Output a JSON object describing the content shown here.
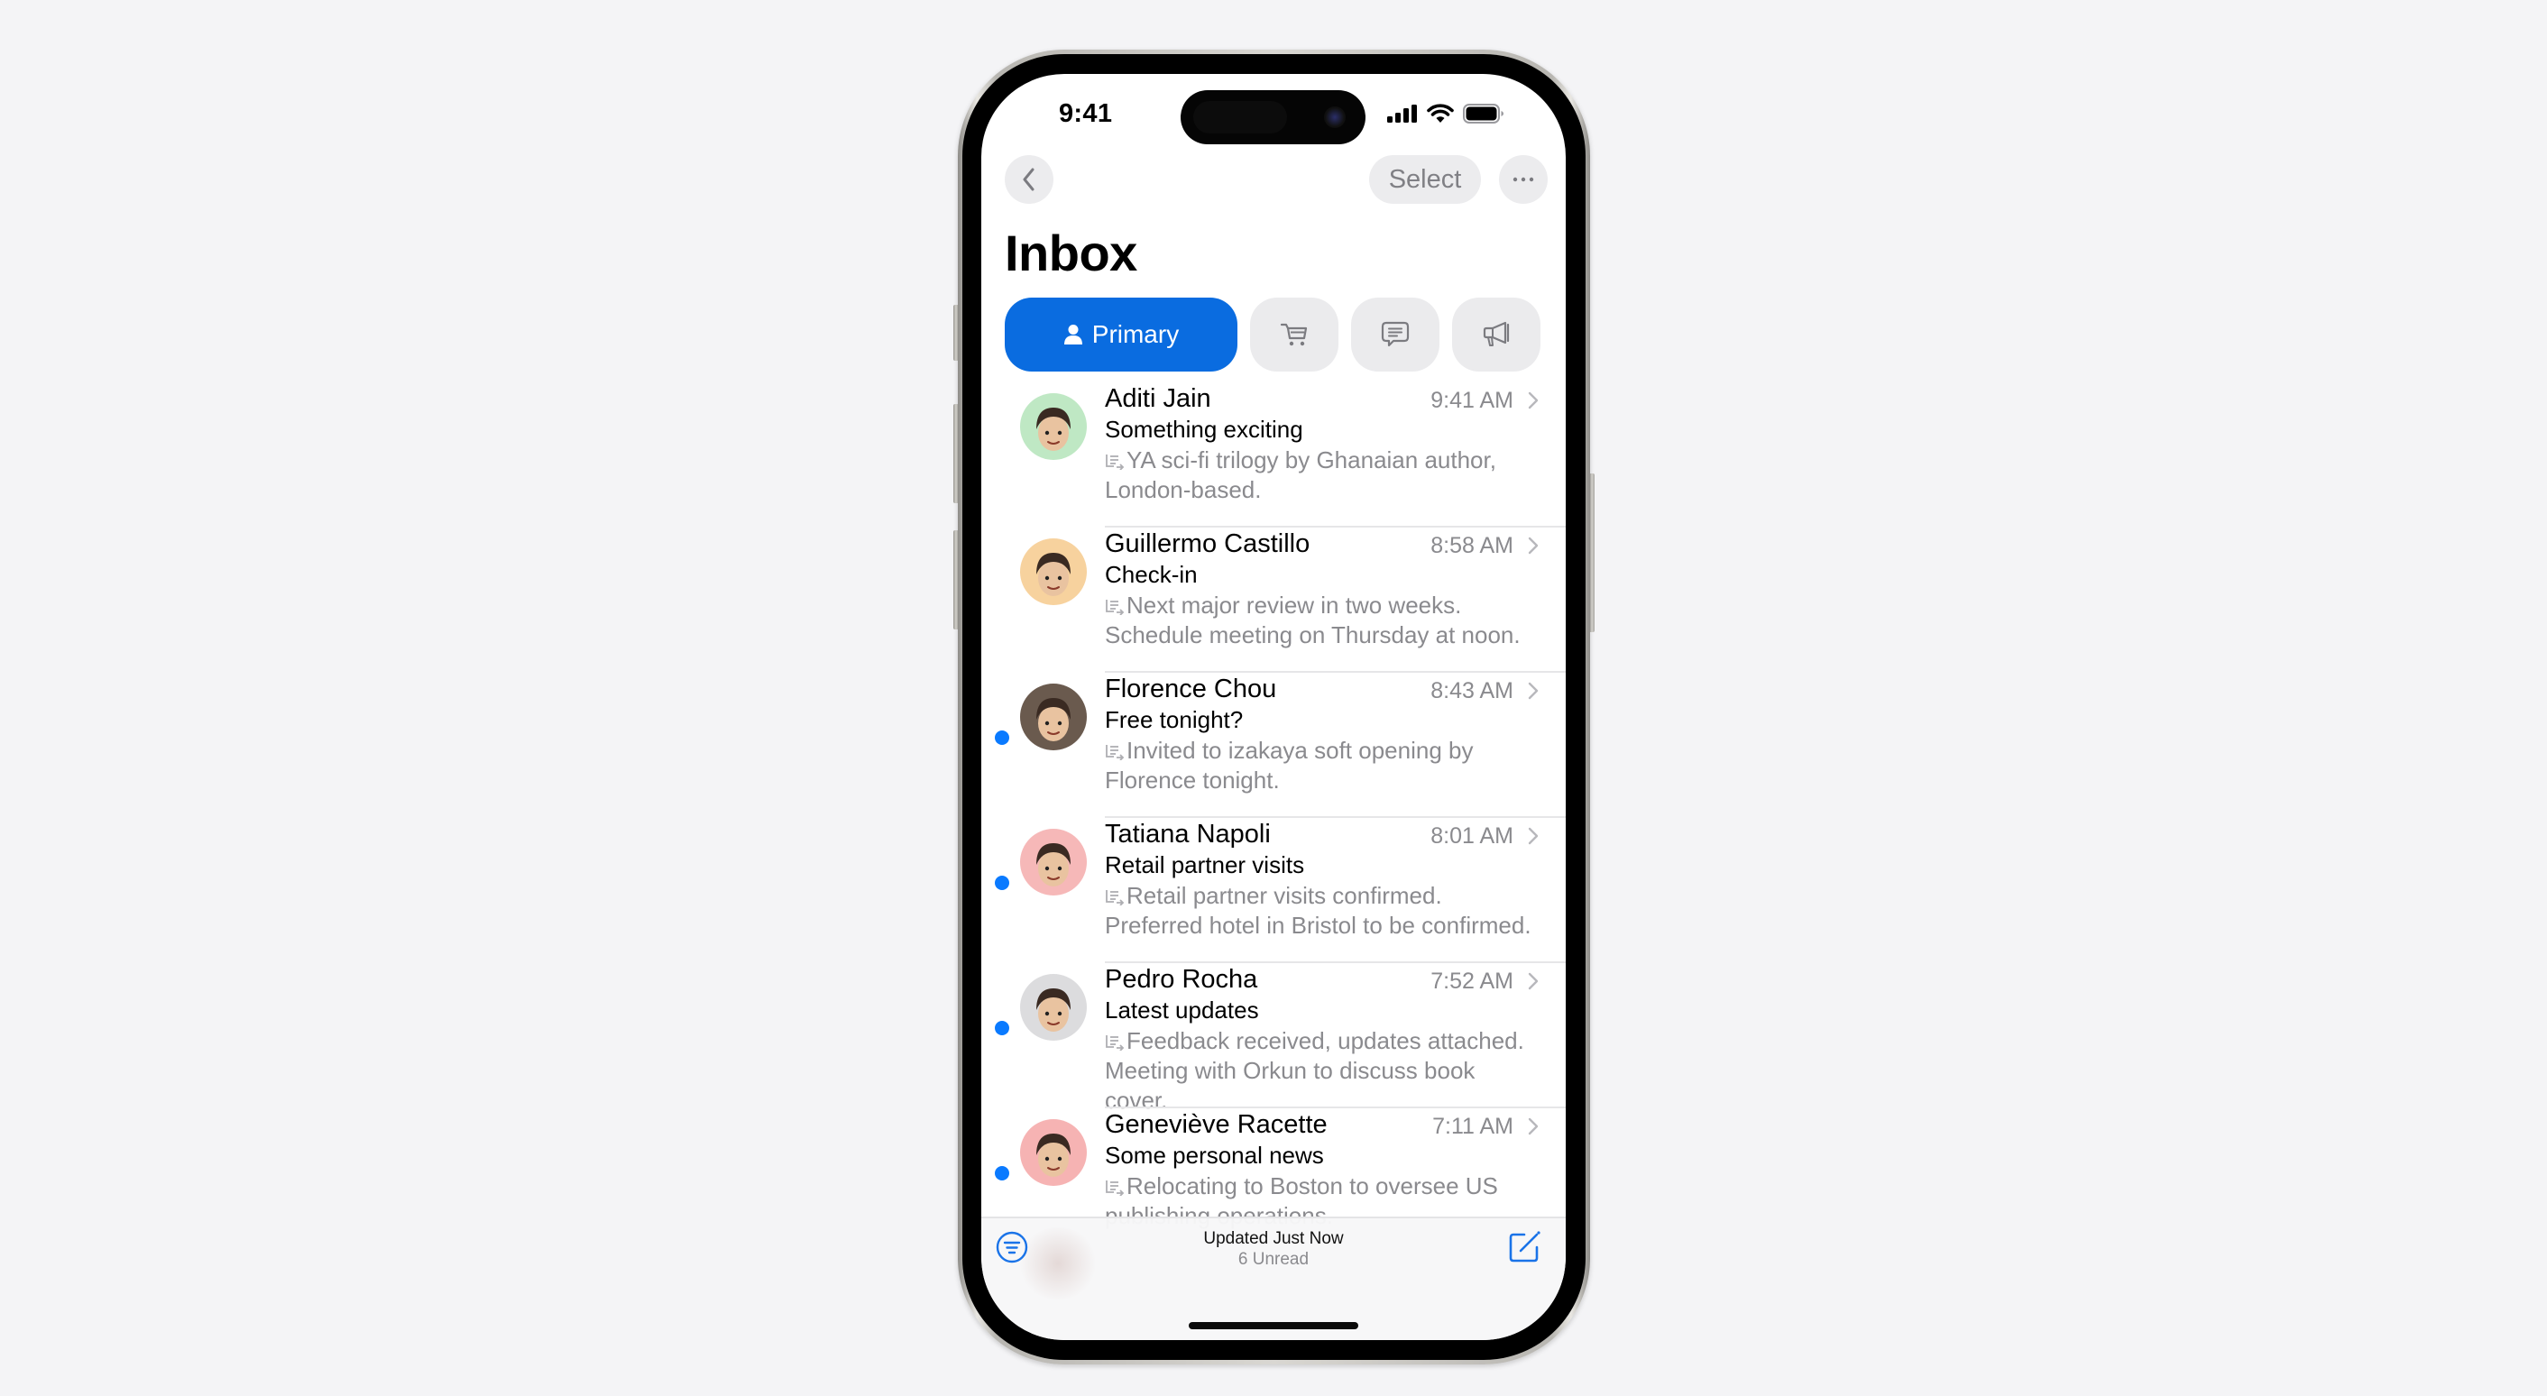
{
  "status_bar": {
    "time": "9:41",
    "icons": [
      "cellular-signal-icon",
      "wifi-icon",
      "battery-icon"
    ]
  },
  "nav": {
    "back_icon": "chevron-left-icon",
    "select_label": "Select",
    "more_icon": "ellipsis-icon"
  },
  "header": {
    "title": "Inbox"
  },
  "categories": [
    {
      "label": "Primary",
      "icon": "person-icon",
      "selected": true
    },
    {
      "label": "",
      "icon": "cart-icon",
      "selected": false
    },
    {
      "label": "",
      "icon": "chat-bubble-icon",
      "selected": false
    },
    {
      "label": "",
      "icon": "megaphone-icon",
      "selected": false
    }
  ],
  "colors": {
    "accent": "#0a6ce0",
    "unread_dot": "#0a7aff",
    "secondary_text": "#8a8a8e"
  },
  "emails": [
    {
      "sender": "Aditi Jain",
      "time": "9:41 AM",
      "subject": "Something exciting",
      "preview": "YA sci-fi trilogy by Ghanaian author, London-based.",
      "unread": false,
      "avatar_bg": "#bfe8c4"
    },
    {
      "sender": "Guillermo Castillo",
      "time": "8:58 AM",
      "subject": "Check-in",
      "preview": "Next major review in two weeks. Schedule meeting on Thursday at noon.",
      "unread": false,
      "avatar_bg": "#f7d29e"
    },
    {
      "sender": "Florence Chou",
      "time": "8:43 AM",
      "subject": "Free tonight?",
      "preview": "Invited to izakaya soft opening by Florence tonight.",
      "unread": true,
      "avatar_bg": "#6a5a4e"
    },
    {
      "sender": "Tatiana Napoli",
      "time": "8:01 AM",
      "subject": "Retail partner visits",
      "preview": "Retail partner visits confirmed. Preferred hotel in Bristol to be confirmed.",
      "unread": true,
      "avatar_bg": "#f6b8b8"
    },
    {
      "sender": "Pedro Rocha",
      "time": "7:52 AM",
      "subject": "Latest updates",
      "preview": "Feedback received, updates attached. Meeting with Orkun to discuss book cover.",
      "unread": true,
      "avatar_bg": "#dcdcde"
    },
    {
      "sender": "Geneviève Racette",
      "time": "7:11 AM",
      "subject": "Some personal news",
      "preview": "Relocating to Boston to oversee US publishing operations.",
      "unread": true,
      "avatar_bg": "#f6b3b3"
    }
  ],
  "toolbar": {
    "status_title": "Updated Just Now",
    "status_subtitle": "6 Unread",
    "filter_icon": "filter-icon",
    "compose_icon": "compose-icon"
  }
}
